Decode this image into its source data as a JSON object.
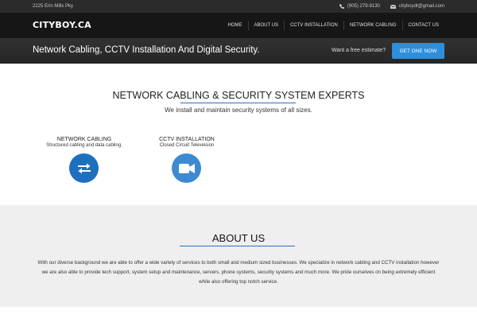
{
  "topbar": {
    "address": "2225 Erin Mills Pky",
    "phone": "(905) 279-9130",
    "email": "cityboydt@gmail.com",
    "phone_icon": "phone-icon",
    "email_icon": "envelope-icon"
  },
  "navbar": {
    "brand": "CITYBOY.CA",
    "items": [
      "HOME",
      "ABOUT US",
      "CCTV INSTALLATION",
      "NETWORK CABLING",
      "CONTACT US"
    ]
  },
  "banner": {
    "title": "Network Cabling, CCTV Installation And Digital Security.",
    "cta_text": "Want a free estimate?",
    "cta_button": "GET ONE NOW"
  },
  "services": {
    "heading": "NETWORK CABLING & SECURITY SYSTEM EXPERTS",
    "subheading": "We install and maintain security systems of all sizes.",
    "items": [
      {
        "title": "NETWORK CABLING",
        "desc": "Structured cabling and data cabling.",
        "icon": "exchange-arrows-icon"
      },
      {
        "title": "CCTV INSTALLATION",
        "desc": "Closed Circuit Televeision",
        "icon": "video-camera-icon"
      }
    ]
  },
  "about": {
    "heading": "ABOUT US",
    "lines": [
      "With our diverse background we are able to offer a wide variety of services to both small and medium sized businesses. We specialize in network cabling and CCTV installation however",
      "we are also able to provide tech support, system setup and maintenance, servers, phone systems, security systems and much more. We pride ourselves on being extremely efficient",
      "while also offering top notch service."
    ]
  },
  "colors": {
    "accent": "#2d8fdc",
    "topbar_bg": "#2b2b2b",
    "navbar_bg": "#161616",
    "about_bg": "#efefef",
    "icon_blue": "#1e6fbf"
  }
}
